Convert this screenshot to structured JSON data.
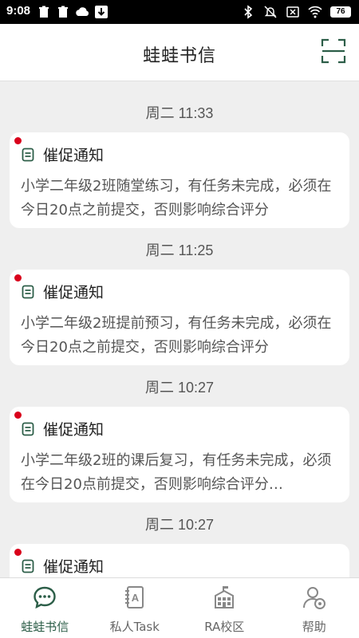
{
  "status_bar": {
    "time": "9:08",
    "battery": "76",
    "left_icons": [
      "trash-icon",
      "trash-icon",
      "cloud-icon",
      "download-icon"
    ],
    "right_icons": [
      "bluetooth-icon",
      "mute-icon",
      "no-sim-icon",
      "wifi-icon",
      "battery-icon"
    ]
  },
  "header": {
    "title": "蛙蛙书信",
    "scan_icon": "scan-icon"
  },
  "colors": {
    "accent": "#2c5e48",
    "unread_dot": "#d9001b",
    "background": "#efefef"
  },
  "messages": [
    {
      "time": "周二 11:33",
      "title": "催促通知",
      "body": "小学二年级2班随堂练习，有任务未完成，必须在今日20点之前提交，否则影响综合评分",
      "unread": true
    },
    {
      "time": "周二 11:25",
      "title": "催促通知",
      "body": "小学二年级2班提前预习，有任务未完成，必须在今日20点之前提交，否则影响综合评分",
      "unread": true
    },
    {
      "time": "周二 10:27",
      "title": "催促通知",
      "body": "小学二年级2班的课后复习，有任务未完成，必须在今日20点前提交，否则影响综合评分…",
      "unread": true
    },
    {
      "time": "周二 10:27",
      "title": "催促通知",
      "body": "",
      "unread": true
    }
  ],
  "bottom_nav": [
    {
      "label": "蛙蛙书信",
      "icon": "chat-icon",
      "active": true
    },
    {
      "label": "私人Task",
      "icon": "notebook-icon",
      "active": false
    },
    {
      "label": "RA校区",
      "icon": "school-icon",
      "active": false
    },
    {
      "label": "帮助",
      "icon": "help-user-icon",
      "active": false
    }
  ]
}
